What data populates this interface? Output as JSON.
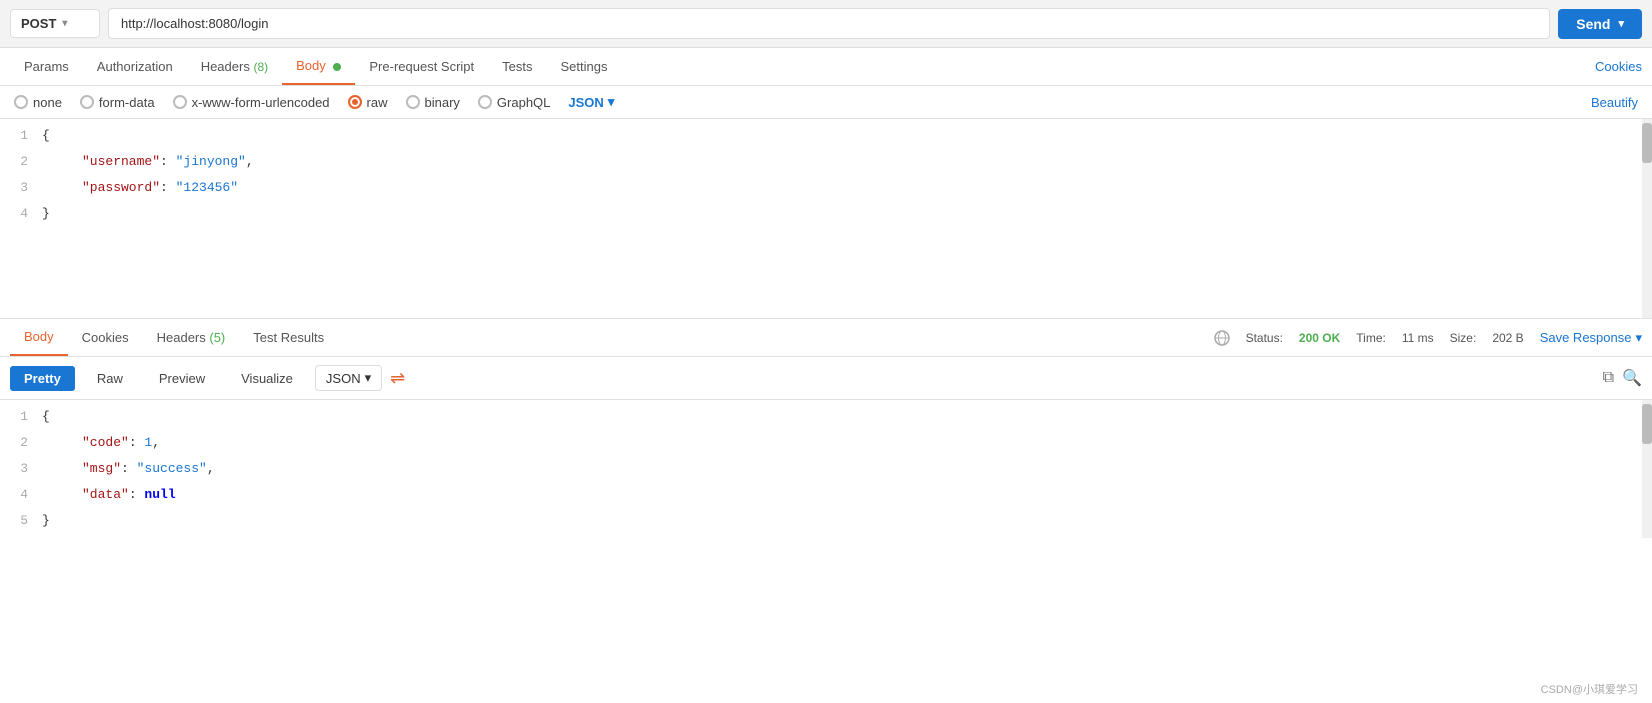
{
  "toolbar": {
    "method": "POST",
    "url": "http://localhost:8080/login",
    "send_label": "Send"
  },
  "request_tabs": [
    {
      "label": "Params",
      "active": false
    },
    {
      "label": "Authorization",
      "active": false
    },
    {
      "label": "Headers",
      "active": false,
      "badge": "(8)"
    },
    {
      "label": "Body",
      "active": true,
      "dot": true
    },
    {
      "label": "Pre-request Script",
      "active": false
    },
    {
      "label": "Tests",
      "active": false
    },
    {
      "label": "Settings",
      "active": false
    }
  ],
  "cookies_link": "Cookies",
  "body_types": [
    {
      "label": "none",
      "selected": false
    },
    {
      "label": "form-data",
      "selected": false
    },
    {
      "label": "x-www-form-urlencoded",
      "selected": false
    },
    {
      "label": "raw",
      "selected": true,
      "orange": true
    },
    {
      "label": "binary",
      "selected": false
    },
    {
      "label": "GraphQL",
      "selected": false
    }
  ],
  "json_dropdown": "JSON",
  "beautify_label": "Beautify",
  "request_body": {
    "lines": [
      {
        "num": "1",
        "content": "{",
        "type": "brace"
      },
      {
        "num": "2",
        "content": "    \"username\": \"jinyong\",",
        "key": "username",
        "val": "jinyong"
      },
      {
        "num": "3",
        "content": "    \"password\": \"123456\"",
        "key": "password",
        "val": "123456"
      },
      {
        "num": "4",
        "content": "}",
        "type": "brace"
      }
    ]
  },
  "response_tabs": [
    {
      "label": "Body",
      "active": true
    },
    {
      "label": "Cookies",
      "active": false
    },
    {
      "label": "Headers",
      "active": false,
      "badge": "(5)"
    },
    {
      "label": "Test Results",
      "active": false
    }
  ],
  "response_status": {
    "status_label": "Status:",
    "status_value": "200 OK",
    "time_label": "Time:",
    "time_value": "11 ms",
    "size_label": "Size:",
    "size_value": "202 B"
  },
  "save_response_label": "Save Response",
  "response_format_tabs": [
    {
      "label": "Pretty",
      "active": true
    },
    {
      "label": "Raw",
      "active": false
    },
    {
      "label": "Preview",
      "active": false
    },
    {
      "label": "Visualize",
      "active": false
    }
  ],
  "response_format_dropdown": "JSON",
  "response_body": {
    "lines": [
      {
        "num": "1",
        "content": "{",
        "type": "brace"
      },
      {
        "num": "2",
        "content": "    \"code\": 1,",
        "key": "code",
        "val": "1",
        "val_type": "num"
      },
      {
        "num": "3",
        "content": "    \"msg\": \"success\",",
        "key": "msg",
        "val": "success",
        "val_type": "string"
      },
      {
        "num": "4",
        "content": "    \"data\": null",
        "key": "data",
        "val": "null",
        "val_type": "null"
      },
      {
        "num": "5",
        "content": "}",
        "type": "brace"
      }
    ]
  },
  "watermark": "CSDN@小琪爱学习"
}
